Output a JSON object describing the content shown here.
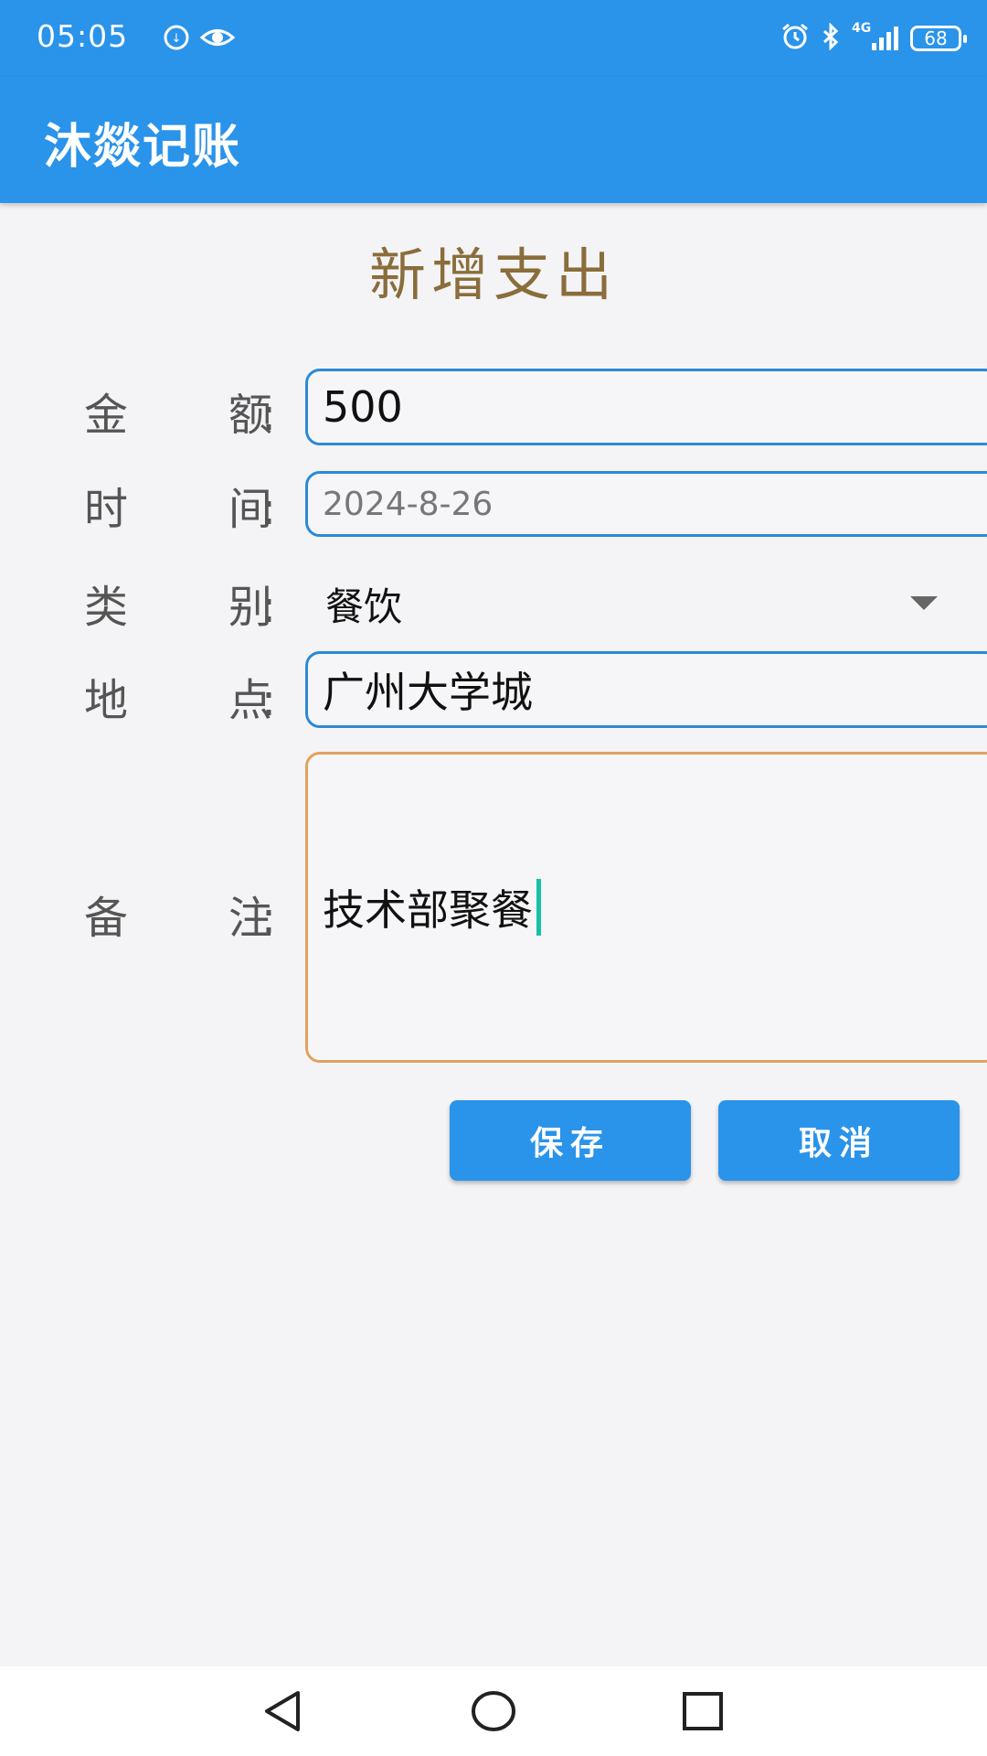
{
  "status_bar": {
    "time": "05:05",
    "battery": "68",
    "signal_label": "4G",
    "icons": [
      "data-saver-icon",
      "eye-icon",
      "alarm-icon",
      "bluetooth-icon",
      "signal-icon",
      "battery-icon"
    ]
  },
  "app_bar": {
    "title": "沐燚记账"
  },
  "form": {
    "title": "新增支出",
    "amount": {
      "label_a": "金",
      "label_b": "额",
      "colon": ":",
      "value": "500"
    },
    "date": {
      "label_a": "时",
      "label_b": "间",
      "colon": ":",
      "value": "2024-8-26"
    },
    "category": {
      "label_a": "类",
      "label_b": "别",
      "colon": ":",
      "value": "餐饮"
    },
    "location": {
      "label_a": "地",
      "label_b": "点",
      "colon": ":",
      "value": "广州大学城"
    },
    "note": {
      "label_a": "备",
      "label_b": "注",
      "colon": ":",
      "value": "技术部聚餐"
    }
  },
  "buttons": {
    "save": "保存",
    "cancel": "取消"
  },
  "colors": {
    "primary": "#2a93ea",
    "title": "#8a6d3b",
    "input_border": "#2b8ad6",
    "note_border": "#e2a25d",
    "cursor": "#19c0a8"
  },
  "nav_bar": {
    "icons": [
      "back-icon",
      "home-icon",
      "recents-icon"
    ]
  }
}
